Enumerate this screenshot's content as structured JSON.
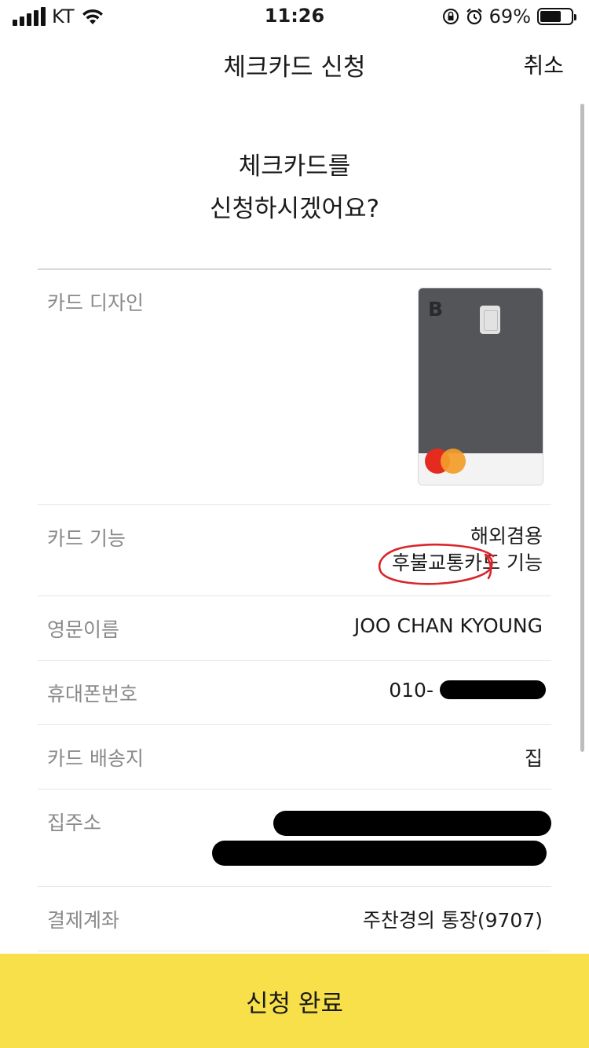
{
  "status_bar": {
    "carrier": "KT",
    "time": "11:26",
    "battery": "69%",
    "battery_level": 0.69
  },
  "nav": {
    "title": "체크카드 신청",
    "cancel_label": "취소"
  },
  "headline": {
    "line1": "체크카드를",
    "line2": "신청하시겠어요?"
  },
  "rows": {
    "card_design": {
      "label": "카드 디자인",
      "card_logo": "B"
    },
    "card_function": {
      "label": "카드 기능",
      "values": [
        "해외겸용",
        "후불교통카드 기능"
      ]
    },
    "english_name": {
      "label": "영문이름",
      "value": "JOO CHAN KYOUNG"
    },
    "phone": {
      "label": "휴대폰번호",
      "value_prefix": "010-"
    },
    "delivery": {
      "label": "카드 배송지",
      "value": "집"
    },
    "home_address": {
      "label": "집주소"
    },
    "payment_account": {
      "label": "결제계좌",
      "value": "주찬경의 통장(9707)"
    }
  },
  "apply_button": {
    "label": "신청 완료"
  },
  "colors": {
    "accent_yellow": "#f8e04a",
    "card_gray": "#545559",
    "annotation_red": "#d8262b",
    "label_gray": "#8a8a8a"
  },
  "icons": [
    "signal-icon",
    "wifi-icon",
    "orientation-lock-icon",
    "alarm-icon",
    "battery-icon",
    "mastercard-logo"
  ]
}
